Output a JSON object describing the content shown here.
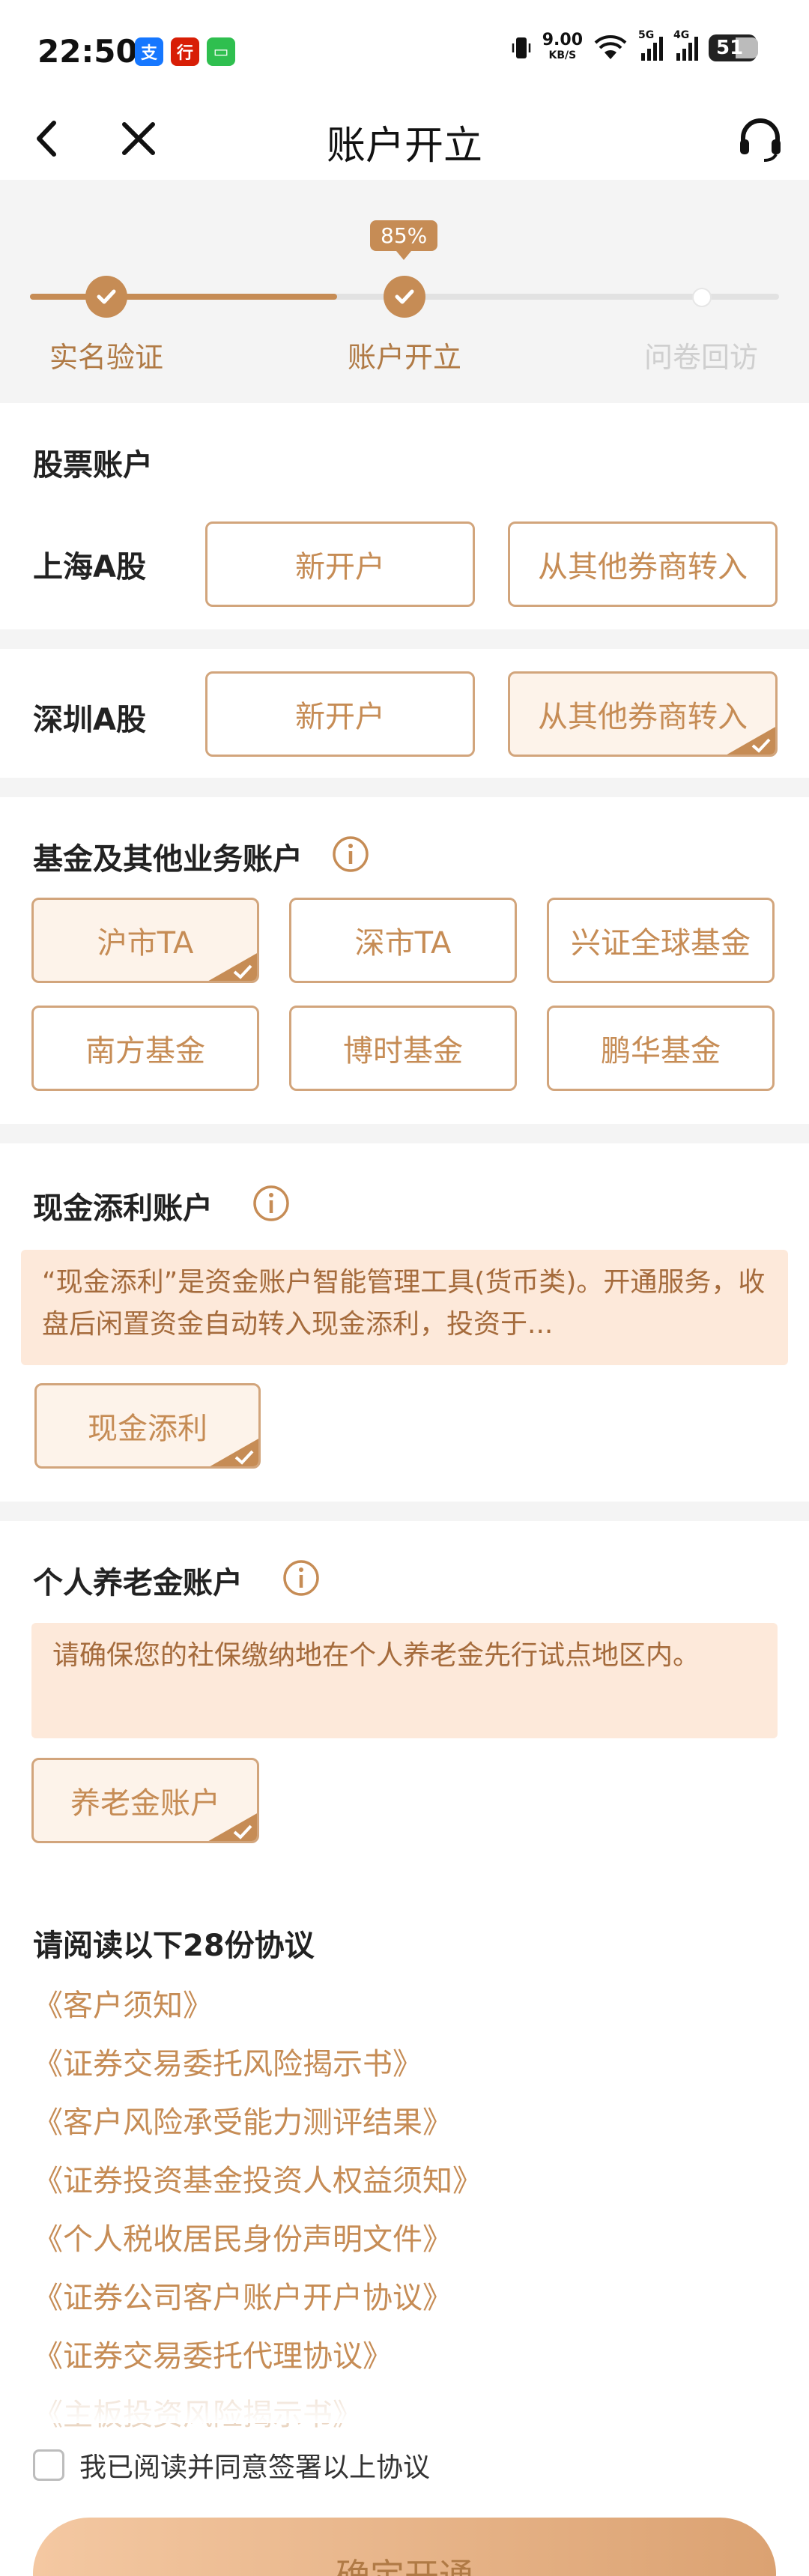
{
  "status_bar": {
    "time": "22:50",
    "apps": [
      {
        "name": "alipay-icon",
        "glyph": "支",
        "color": "#1677ff"
      },
      {
        "name": "bank-app-icon",
        "glyph": "行",
        "color": "#d81e06"
      },
      {
        "name": "message-app-icon",
        "glyph": "▭",
        "color": "#2fbf4f"
      }
    ],
    "net_speed": "9.00",
    "net_unit": "KB/S",
    "sig1_label": "5G",
    "sig2_label": "4G",
    "battery": "51"
  },
  "nav": {
    "title": "账户开立"
  },
  "progress": {
    "percent_label": "85%",
    "fraction": 0.41,
    "steps": [
      {
        "label": "实名验证",
        "state": "done"
      },
      {
        "label": "账户开立",
        "state": "current"
      },
      {
        "label": "问卷回访",
        "state": "pending"
      }
    ]
  },
  "stock": {
    "title": "股票账户",
    "shanghai": {
      "label": "上海A股",
      "new_label": "新开户",
      "transfer_label": "从其他券商转入"
    },
    "shenzhen": {
      "label": "深圳A股",
      "new_label": "新开户",
      "transfer_label": "从其他券商转入"
    }
  },
  "fund": {
    "title": "基金及其他业务账户",
    "options": [
      {
        "label": "沪市TA",
        "selected": true
      },
      {
        "label": "深市TA",
        "selected": false
      },
      {
        "label": "兴证全球基金",
        "selected": false
      },
      {
        "label": "南方基金",
        "selected": false
      },
      {
        "label": "博时基金",
        "selected": false
      },
      {
        "label": "鹏华基金",
        "selected": false
      }
    ]
  },
  "cash": {
    "title": "现金添利账户",
    "notice": "“现金添利”是资金账户智能管理工具(货币类)。开通服务，收盘后闲置资金自动转入现金添利，投资于...",
    "option": "现金添利"
  },
  "pension": {
    "title": "个人养老金账户",
    "notice": "请确保您的社保缴纳地在个人养老金先行试点地区内。",
    "option": "养老金账户"
  },
  "agreements": {
    "title": "请阅读以下28份协议",
    "items": [
      "《客户须知》",
      "《证券交易委托风险揭示书》",
      "《客户风险承受能力测评结果》",
      "《证券投资基金投资人权益须知》",
      "《个人税收居民身份声明文件》",
      "《证券公司客户账户开户协议》",
      "《证券交易委托代理协议》",
      "《主板投资风险揭示书》"
    ],
    "consent": "我已阅读并同意签署以上协议",
    "confirm": "确定开通"
  },
  "colors": {
    "accent": "#c68c55",
    "accent_border": "#d2a57c",
    "notice_bg": "#fde9da"
  }
}
